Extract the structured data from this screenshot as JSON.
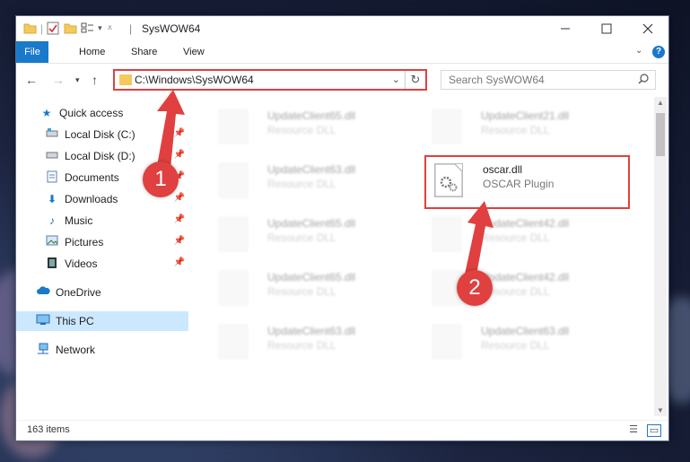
{
  "window": {
    "title": "SysWOW64",
    "controls": [
      "minimize",
      "maximize",
      "close"
    ]
  },
  "ribbon": {
    "tabs": [
      "File",
      "Home",
      "Share",
      "View"
    ],
    "help": "?"
  },
  "address_bar": {
    "path": "C:\\Windows\\SysWOW64"
  },
  "search": {
    "placeholder": "Search SysWOW64"
  },
  "sidebar": {
    "items": [
      {
        "label": "Quick access",
        "icon": "star-icon"
      },
      {
        "label": "Local Disk (C:)",
        "icon": "drive-icon",
        "pinned": true
      },
      {
        "label": "Local Disk (D:)",
        "icon": "drive-icon",
        "pinned": true
      },
      {
        "label": "Documents",
        "icon": "documents-icon",
        "pinned": true
      },
      {
        "label": "Downloads",
        "icon": "download-icon",
        "pinned": true
      },
      {
        "label": "Music",
        "icon": "music-icon",
        "pinned": true
      },
      {
        "label": "Pictures",
        "icon": "pictures-icon",
        "pinned": true
      },
      {
        "label": "Videos",
        "icon": "videos-icon",
        "pinned": true
      },
      {
        "label": "OneDrive",
        "icon": "cloud-icon"
      },
      {
        "label": "This PC",
        "icon": "computer-icon",
        "selected": true
      },
      {
        "label": "Network",
        "icon": "network-icon"
      }
    ]
  },
  "files": [
    {
      "name": "UpdateClient65.dll",
      "type": "Resource DLL"
    },
    {
      "name": "UpdateClient21.dll",
      "type": "Resource DLL"
    },
    {
      "name": "UpdateClient63.dll",
      "type": "Resource DLL"
    },
    {
      "name": "oscar.dll",
      "type": "OSCAR Plugin",
      "highlighted": true
    },
    {
      "name": "UpdateClient65.dll",
      "type": "Resource DLL"
    },
    {
      "name": "UpdateClient42.dll",
      "type": "Resource DLL"
    },
    {
      "name": "UpdateClient65.dll",
      "type": "Resource DLL"
    },
    {
      "name": "UpdateClient42.dll",
      "type": "Resource DLL"
    },
    {
      "name": "UpdateClient63.dll",
      "type": "Resource DLL"
    },
    {
      "name": "UpdateClient63.dll",
      "type": "Resource DLL"
    }
  ],
  "status": {
    "item_count": "163 items"
  },
  "annotations": {
    "step1": "1",
    "step2": "2",
    "color": "#e0403f"
  }
}
